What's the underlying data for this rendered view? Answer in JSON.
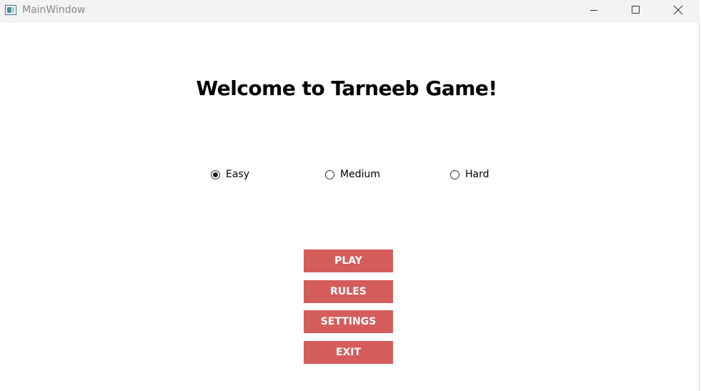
{
  "window": {
    "title": "MainWindow",
    "icon": "window-app-icon",
    "controls": [
      "minimize-icon",
      "maximize-icon",
      "close-icon"
    ]
  },
  "main": {
    "heading": "Welcome to Tarneeb Game!",
    "difficulty": {
      "options": [
        {
          "label": "Easy",
          "checked": true
        },
        {
          "label": "Medium",
          "checked": false
        },
        {
          "label": "Hard",
          "checked": false
        }
      ]
    },
    "buttons": {
      "play": "PLAY",
      "rules": "RULES",
      "settings": "SETTINGS",
      "exit": "EXIT"
    }
  },
  "colors": {
    "button_bg": "#d45d5c",
    "button_text": "#ffffff",
    "titlebar_bg": "#f3f3f3"
  }
}
